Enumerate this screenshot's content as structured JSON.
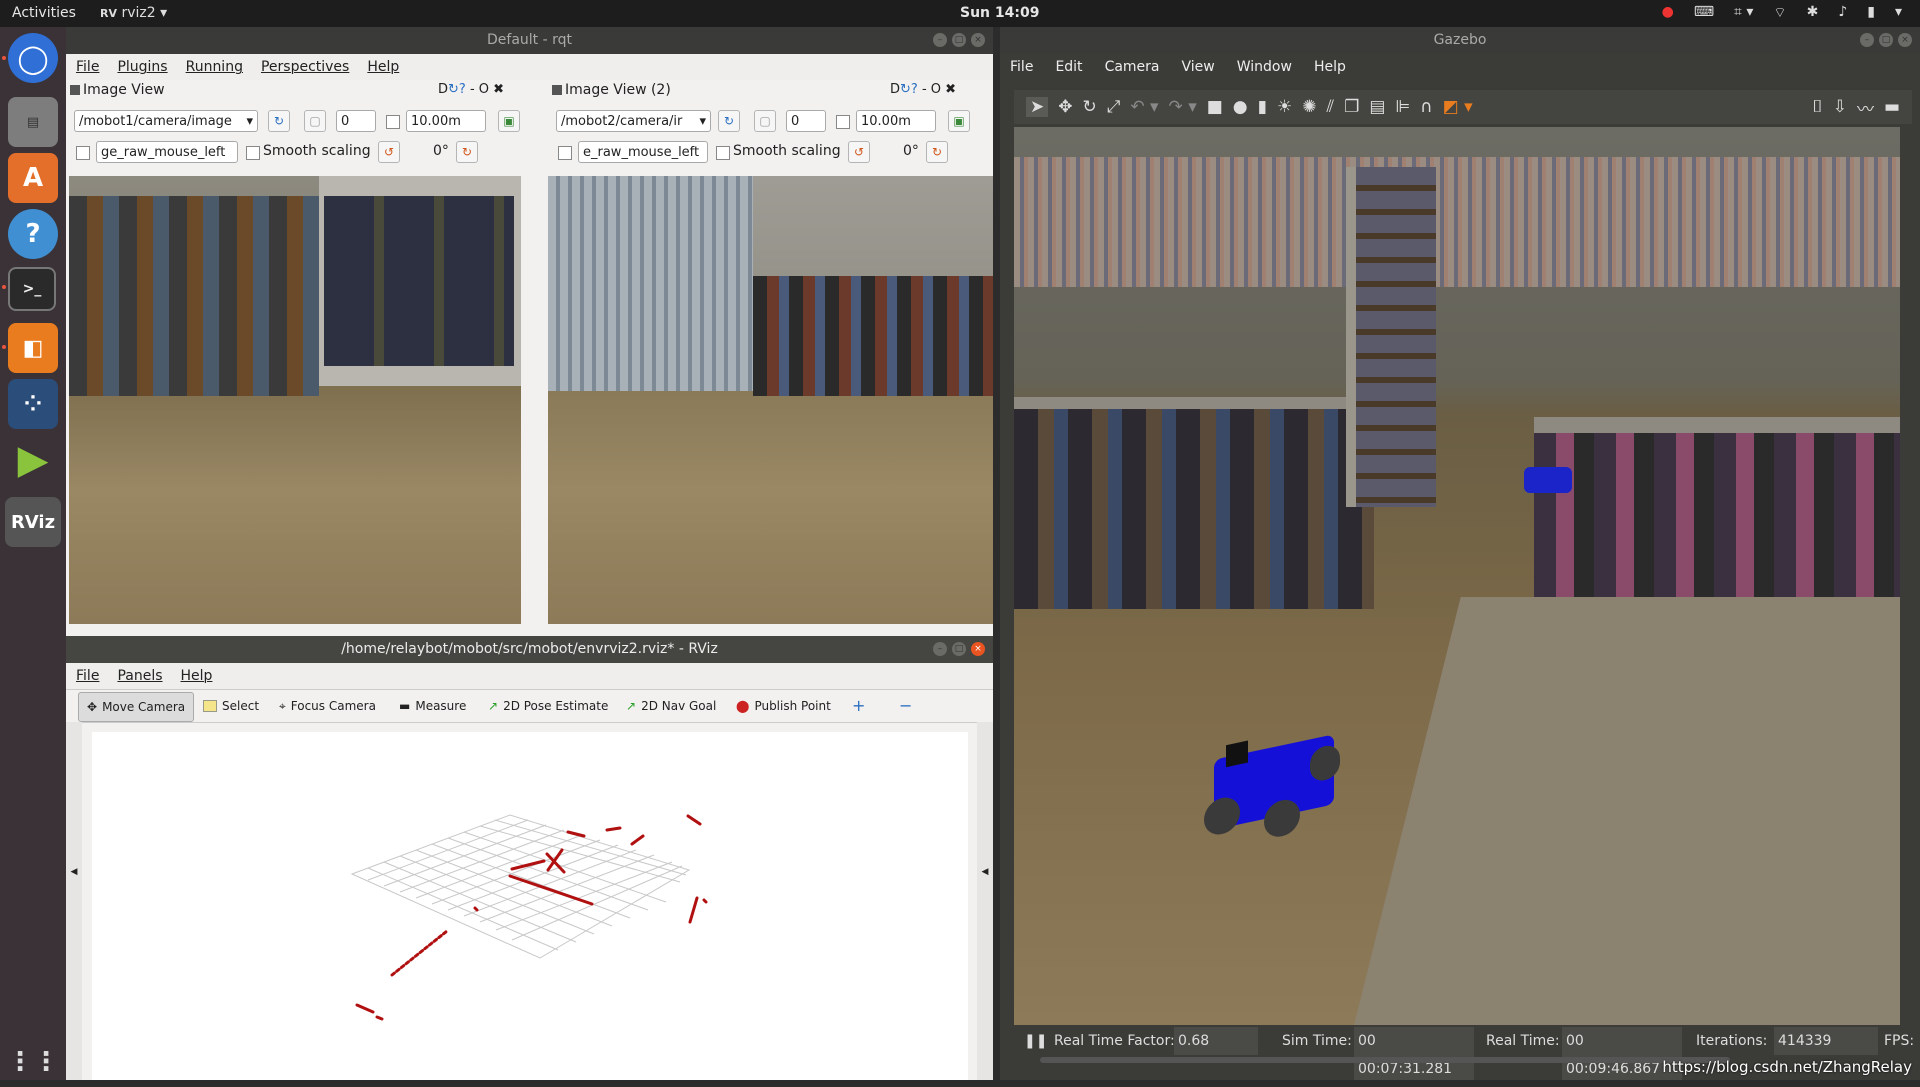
{
  "topbar": {
    "activities": "Activities",
    "app": "rviz2",
    "clock": "Sun 14:09"
  },
  "dock": {
    "items": [
      "chromium-icon",
      "files-icon",
      "software-center-icon",
      "help-icon",
      "terminal-icon",
      "blender-icon",
      "apps-grid-icon",
      "play-icon",
      "rviz-icon"
    ],
    "rviz_label": "RViz"
  },
  "rqt": {
    "title": "Default - rqt",
    "menu": [
      "File",
      "Plugins",
      "Running",
      "Perspectives",
      "Help"
    ],
    "panels": [
      {
        "title": "Image View",
        "topic": "/mobot1/camera/image",
        "num": "0",
        "range": "10.00m",
        "mouse": "ge_raw_mouse_left",
        "smooth": "Smooth scaling",
        "rot": "0°",
        "dock": "D"
      },
      {
        "title": "Image View (2)",
        "topic": "/mobot2/camera/ir",
        "num": "0",
        "range": "10.00m",
        "mouse": "e_raw_mouse_left",
        "smooth": "Smooth scaling",
        "rot": "0°",
        "dock": "D"
      }
    ]
  },
  "rviz": {
    "title": "/home/relaybot/mobot/src/mobot/envrviz2.rviz* - RViz",
    "menu": [
      "File",
      "Panels",
      "Help"
    ],
    "tools": [
      "Move Camera",
      "Select",
      "Focus Camera",
      "Measure",
      "2D Pose Estimate",
      "2D Nav Goal",
      "Publish Point"
    ]
  },
  "gazebo": {
    "title": "Gazebo",
    "menu": [
      "File",
      "Edit",
      "Camera",
      "View",
      "Window",
      "Help"
    ],
    "status": {
      "rtf_label": "Real Time Factor:",
      "rtf": "0.68",
      "sim_label": "Sim Time:",
      "sim": "00 00:07:31.281",
      "real_label": "Real Time:",
      "real": "00 00:09:46.867",
      "iter_label": "Iterations:",
      "iter": "414339",
      "fps_label": "FPS:"
    }
  },
  "watermark": "https://blog.csdn.net/ZhangRelay"
}
